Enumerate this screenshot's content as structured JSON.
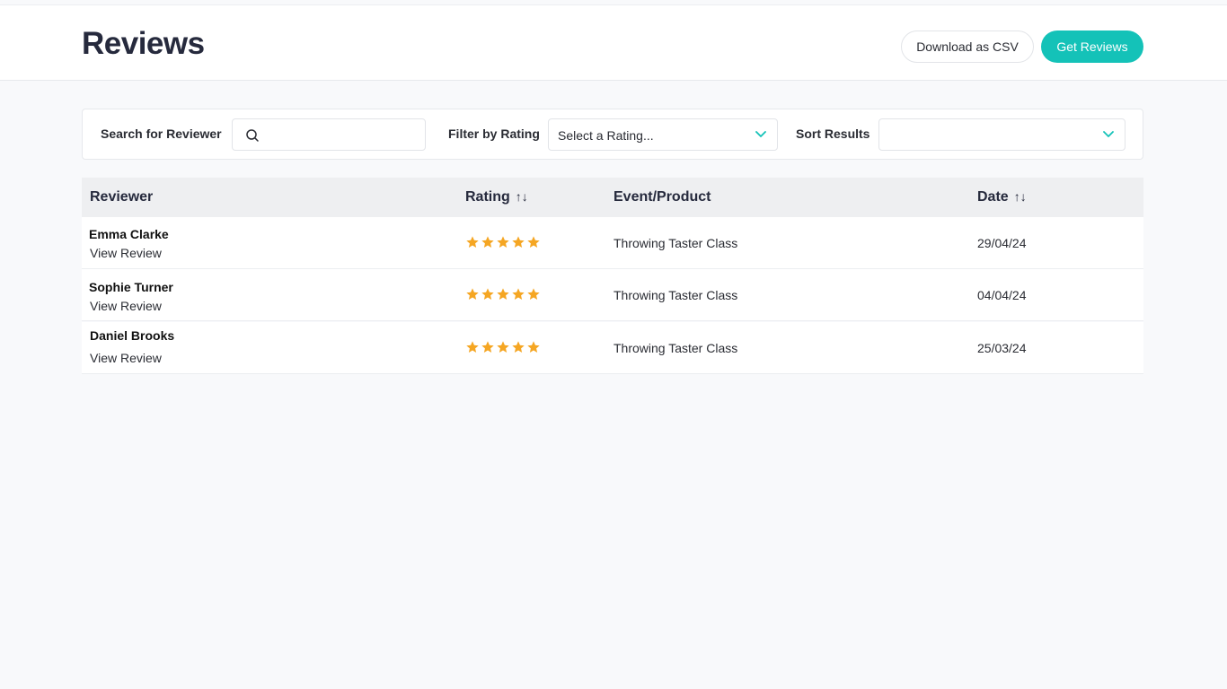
{
  "header": {
    "title": "Reviews",
    "download_label": "Download as CSV",
    "get_reviews_label": "Get Reviews"
  },
  "filters": {
    "search_label": "Search for Reviewer",
    "search_value": "",
    "rating_label": "Filter by Rating",
    "rating_selected": "Select a Rating...",
    "sort_label": "Sort Results",
    "sort_selected": ""
  },
  "table": {
    "columns": {
      "reviewer": "Reviewer",
      "rating": "Rating",
      "event": "Event/Product",
      "date": "Date"
    },
    "rows": [
      {
        "name": "Emma Clarke",
        "view_label": "View Review",
        "stars": 5,
        "event": "Throwing Taster Class",
        "date": "29/04/24"
      },
      {
        "name": "Sophie Turner",
        "view_label": "View Review",
        "stars": 5,
        "event": "Throwing Taster Class",
        "date": "04/04/24"
      },
      {
        "name": "Daniel Brooks",
        "view_label": "View Review",
        "stars": 5,
        "event": "Throwing Taster Class",
        "date": "25/03/24"
      }
    ]
  },
  "colors": {
    "accent": "#14c2b8",
    "star": "#f5a623"
  },
  "icons": {
    "search": "search-icon",
    "dropdown": "chevron-down-icon",
    "sort": "sort-arrows-icon",
    "star": "star-icon"
  }
}
